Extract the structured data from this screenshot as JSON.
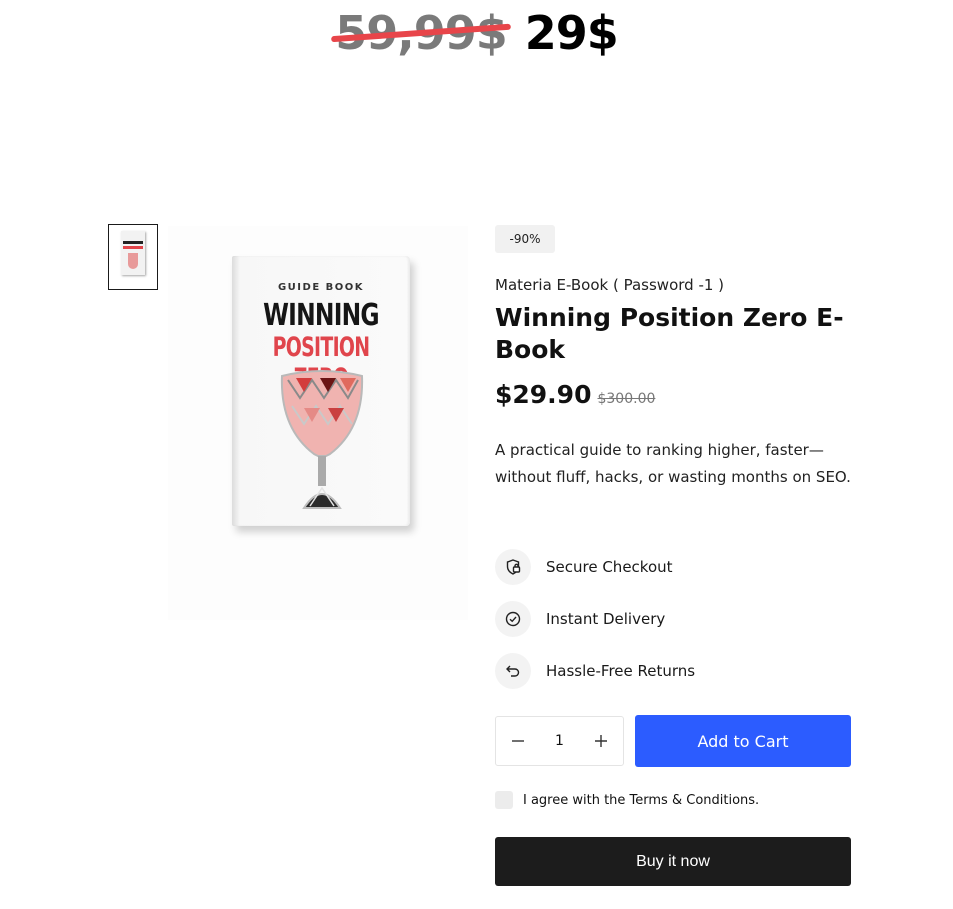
{
  "promo": {
    "old_price": "59,99$",
    "new_price": "29$"
  },
  "gallery": {
    "thumbnail_alt": "Winning Position Zero E-Book thumbnail",
    "book": {
      "label": "GUIDE BOOK",
      "title_line1": "WINNING",
      "title_line2": "POSITION ZERO"
    }
  },
  "product": {
    "discount_badge": "-90%",
    "vendor": "Materia E-Book ( Password -1 )",
    "title": "Winning Position Zero E-Book",
    "price": "$29.90",
    "compare_price": "$300.00",
    "description": "A practical guide to ranking higher, faster—without fluff, hacks, or wasting months on SEO."
  },
  "features": [
    {
      "label": "Secure Checkout",
      "icon": "secure-checkout-icon"
    },
    {
      "label": "Instant Delivery",
      "icon": "check-circle-icon"
    },
    {
      "label": "Hassle-Free Returns",
      "icon": "return-arrow-icon"
    }
  ],
  "purchase": {
    "quantity": "1",
    "add_to_cart": "Add to Cart",
    "terms_label": "I agree with the Terms & Conditions.",
    "buy_now": "Buy it now"
  },
  "colors": {
    "accent_blue": "#2c5cff",
    "buy_button": "#1c1c1c",
    "strike_red": "#e8454a",
    "book_red": "#e0454c"
  }
}
